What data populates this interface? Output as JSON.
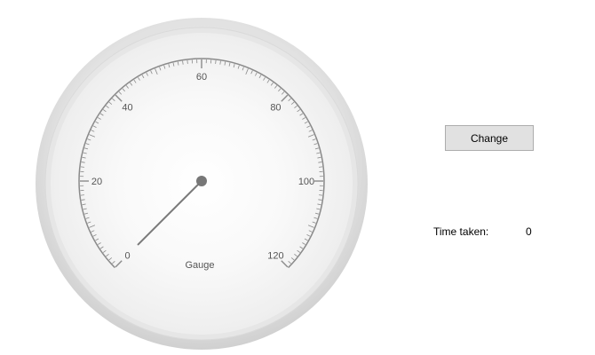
{
  "gauge": {
    "caption": "Gauge",
    "min": 0,
    "max": 120,
    "major_labels": [
      "0",
      "20",
      "40",
      "60",
      "80",
      "100",
      "120"
    ],
    "value": 0,
    "needle_color": "#7a7a7a",
    "tick_color": "#8a8a8a",
    "label_color": "#555555"
  },
  "controls": {
    "change_label": "Change",
    "time_label": "Time taken:",
    "time_value": "0"
  }
}
